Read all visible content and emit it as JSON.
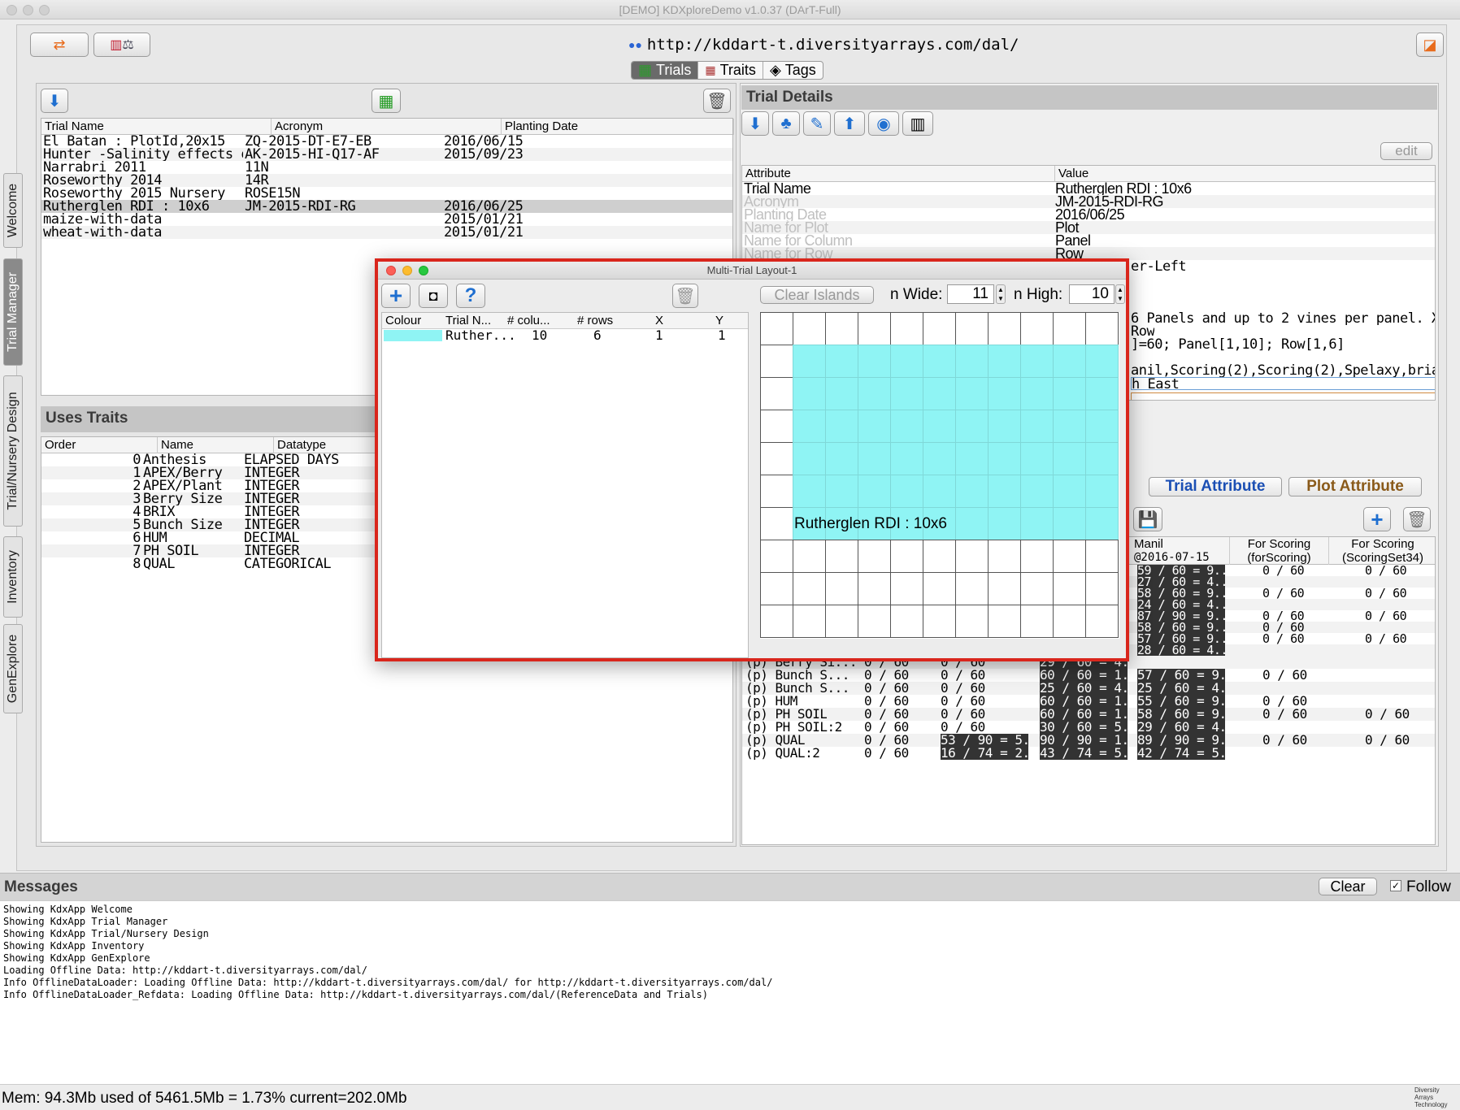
{
  "window": {
    "title": "[DEMO] KDXploreDemo v1.0.37 (DArT-Full)"
  },
  "toolbar": {
    "url": "http://kddart-t.diversityarrays.com/dal/"
  },
  "tabs": [
    {
      "label": "Trials"
    },
    {
      "label": "Traits"
    },
    {
      "label": "Tags"
    }
  ],
  "side_tabs": [
    {
      "label": "Welcome"
    },
    {
      "label": "Trial Manager"
    },
    {
      "label": "Trial/Nursery Design"
    },
    {
      "label": "Inventory"
    },
    {
      "label": "GenExplore"
    }
  ],
  "trials": {
    "columns": [
      "Trial Name",
      "Acronym",
      "Planting Date"
    ],
    "rows": [
      [
        "El Batan : PlotId,20x15",
        "ZQ-2015-DT-E7-EB",
        "2016/06/15"
      ],
      [
        "Hunter -Salinity effects on BRIX:...",
        "AK-2015-HI-Q17-AF",
        "2015/09/23"
      ],
      [
        "Narrabri 2011",
        "11N",
        ""
      ],
      [
        "Roseworthy 2014",
        "14R",
        ""
      ],
      [
        "Roseworthy 2015 Nursery",
        "ROSE15N",
        ""
      ],
      [
        "Rutherglen RDI : 10x6",
        "JM-2015-RDI-RG",
        "2016/06/25"
      ],
      [
        "maize-with-data",
        "",
        "2015/01/21"
      ],
      [
        "wheat-with-data",
        "",
        "2015/01/21"
      ]
    ]
  },
  "uses_traits": {
    "title": "Uses Traits",
    "columns": [
      "Order",
      "Name",
      "Datatype"
    ],
    "rows": [
      [
        "0",
        "Anthesis",
        "ELAPSED DAYS"
      ],
      [
        "1",
        "APEX/Berry",
        "INTEGER"
      ],
      [
        "2",
        "APEX/Plant",
        "INTEGER"
      ],
      [
        "3",
        "Berry Size",
        "INTEGER"
      ],
      [
        "4",
        "BRIX",
        "INTEGER"
      ],
      [
        "5",
        "Bunch Size",
        "INTEGER"
      ],
      [
        "6",
        "HUM",
        "DECIMAL"
      ],
      [
        "7",
        "PH SOIL",
        "INTEGER"
      ],
      [
        "8",
        "QUAL",
        "CATEGORICAL"
      ]
    ]
  },
  "trial_details": {
    "title": "Trial Details",
    "edit_label": "edit",
    "columns": [
      "Attribute",
      "Value"
    ],
    "rows": [
      [
        "Trial Name",
        "Rutherglen RDI : 10x6"
      ],
      [
        "Acronym",
        "JM-2015-RDI-RG"
      ],
      [
        "Planting Date",
        "2016/06/25"
      ],
      [
        "Name for Plot",
        "Plot"
      ],
      [
        "Name for Column",
        "Panel"
      ],
      [
        "Name for Row",
        "Row"
      ]
    ],
    "partial_lines": [
      "er-Left",
      "6 Panels and up to 2 vines per panel. X,Y a...",
      "Row",
      "]=60; Panel[1,10]; Row[1,6]",
      "anil,Scoring(2),Scoring(2),Spelaxy,brian",
      "h  East"
    ],
    "trial_attribute_label": "Trial Attribute",
    "plot_attribute_label": "Plot Attribute"
  },
  "scoring": {
    "headers": [
      {
        "l1": "Manil",
        "l2": "@2016-07-15"
      },
      {
        "l1": "For Scoring",
        "l2": "(forScoring)"
      },
      {
        "l1": "For Scoring",
        "l2": "(ScoringSet34)"
      }
    ],
    "upper_rows": [
      [
        "59 / 60 = 9...",
        "0 / 60",
        "0 / 60"
      ],
      [
        "27 / 60 = 4...",
        "",
        ""
      ],
      [
        "58 / 60 = 9...",
        "0 / 60",
        "0 / 60"
      ],
      [
        "24 / 60 = 4...",
        "",
        ""
      ],
      [
        "87 / 90 = 9...",
        "0 / 60",
        "0 / 60"
      ],
      [
        "58 / 60 = 9...",
        "0 / 60",
        ""
      ],
      [
        "57 / 60 = 9...",
        "0 / 60",
        "0 / 60"
      ],
      [
        "28 / 60 = 4...",
        "",
        ""
      ]
    ],
    "lower_rows": [
      [
        "(p)  Berry Si...",
        "0 / 60",
        "0 / 60",
        "29 / 60 = 4...",
        "",
        ""
      ],
      [
        "(p)  Bunch S...",
        "0 / 60",
        "0 / 60",
        "60 / 60 = 1...",
        "57 / 60 = 9...",
        "0 / 60",
        ""
      ],
      [
        "(p)  Bunch S...",
        "0 / 60",
        "0 / 60",
        "25 / 60 = 4...",
        "25 / 60 = 4...",
        "",
        ""
      ],
      [
        "(p)  HUM",
        "0 / 60",
        "0 / 60",
        "60 / 60 = 1...",
        "55 / 60 = 9...",
        "0 / 60",
        ""
      ],
      [
        "(p)  PH  SOIL",
        "0 / 60",
        "0 / 60",
        "60 / 60 = 1...",
        "58 / 60 = 9...",
        "0 / 60",
        "0 / 60"
      ],
      [
        "(p)  PH  SOIL:2",
        "0 / 60",
        "0 / 60",
        "30 / 60 = 5...",
        "29 / 60 = 4...",
        "",
        ""
      ],
      [
        "(p)  QUAL",
        "0 / 60",
        "53 / 90 = 5...",
        "90 / 90 = 1...",
        "89 / 90 = 9...",
        "0 / 60",
        "0 / 60"
      ],
      [
        "(p)  QUAL:2",
        "0 / 60",
        "16 / 74 = 2...",
        "43 / 74 = 5...",
        "42 / 74 = 5...",
        "",
        ""
      ]
    ]
  },
  "dialog": {
    "title": "Multi-Trial Layout-1",
    "clear_islands": "Clear Islands",
    "n_wide_label": "n Wide:",
    "n_wide": "11",
    "n_high_label": "n High:",
    "n_high": "10",
    "columns": [
      "Colour",
      "Trial N...",
      "# colu...",
      "# rows",
      "X",
      "Y"
    ],
    "row": [
      "Ruther...",
      "10",
      "6",
      "1",
      "1"
    ],
    "trial_label": "Rutherglen RDI : 10x6",
    "swatch_color": "#8ff4f4"
  },
  "messages": {
    "title": "Messages",
    "clear_label": "Clear",
    "follow_label": "Follow",
    "lines": [
      "Showing KdxApp Welcome",
      "Showing KdxApp Trial Manager",
      "Showing KdxApp Trial/Nursery Design",
      "Showing KdxApp Inventory",
      "Showing KdxApp GenExplore",
      "Loading Offline Data: http://kddart-t.diversityarrays.com/dal/",
      "Info OfflineDataLoader: Loading Offline Data: http://kddart-t.diversityarrays.com/dal/ for http://kddart-t.diversityarrays.com/dal/",
      "Info OfflineDataLoader_Refdata: Loading Offline Data: http://kddart-t.diversityarrays.com/dal/(ReferenceData and Trials)"
    ]
  },
  "status": {
    "memory": "Mem: 94.3Mb used of 5461.5Mb =  1.73% current=202.0Mb",
    "logo_text": "Diversity Arrays Technology"
  }
}
